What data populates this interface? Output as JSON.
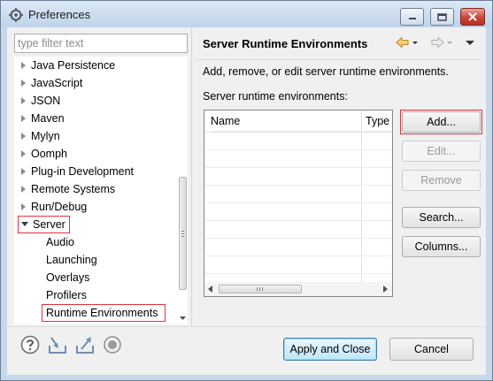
{
  "window": {
    "title": "Preferences",
    "icon": "preferences-gear-icon"
  },
  "filter": {
    "placeholder": "type filter text",
    "value": ""
  },
  "tree": {
    "items": [
      {
        "label": "Java Persistence",
        "level": 0,
        "expandable": true,
        "expanded": false
      },
      {
        "label": "JavaScript",
        "level": 0,
        "expandable": true,
        "expanded": false
      },
      {
        "label": "JSON",
        "level": 0,
        "expandable": true,
        "expanded": false
      },
      {
        "label": "Maven",
        "level": 0,
        "expandable": true,
        "expanded": false
      },
      {
        "label": "Mylyn",
        "level": 0,
        "expandable": true,
        "expanded": false
      },
      {
        "label": "Oomph",
        "level": 0,
        "expandable": true,
        "expanded": false
      },
      {
        "label": "Plug-in Development",
        "level": 0,
        "expandable": true,
        "expanded": false
      },
      {
        "label": "Remote Systems",
        "level": 0,
        "expandable": true,
        "expanded": false
      },
      {
        "label": "Run/Debug",
        "level": 0,
        "expandable": true,
        "expanded": false
      },
      {
        "label": "Server",
        "level": 0,
        "expandable": true,
        "expanded": true,
        "highlighted": true
      },
      {
        "label": "Audio",
        "level": 1
      },
      {
        "label": "Launching",
        "level": 1
      },
      {
        "label": "Overlays",
        "level": 1
      },
      {
        "label": "Profilers",
        "level": 1
      },
      {
        "label": "Runtime Environments",
        "level": 1,
        "selected": true,
        "highlighted": true
      }
    ]
  },
  "page": {
    "title": "Server Runtime Environments",
    "description": "Add, remove, or edit server runtime environments.",
    "list_label": "Server runtime environments:",
    "table": {
      "columns": [
        "Name",
        "Type"
      ],
      "rows": []
    }
  },
  "buttons": {
    "add": "Add...",
    "edit": "Edit...",
    "remove": "Remove",
    "search": "Search...",
    "columns": "Columns..."
  },
  "footer": {
    "apply_close": "Apply and Close",
    "cancel": "Cancel",
    "icons": [
      "help-icon",
      "import-icon",
      "export-icon",
      "record-icon"
    ]
  },
  "colors": {
    "highlight_box": "#e0323b",
    "primary_button_border": "#3c7fb1",
    "back_arrow": "#e8b64a"
  }
}
